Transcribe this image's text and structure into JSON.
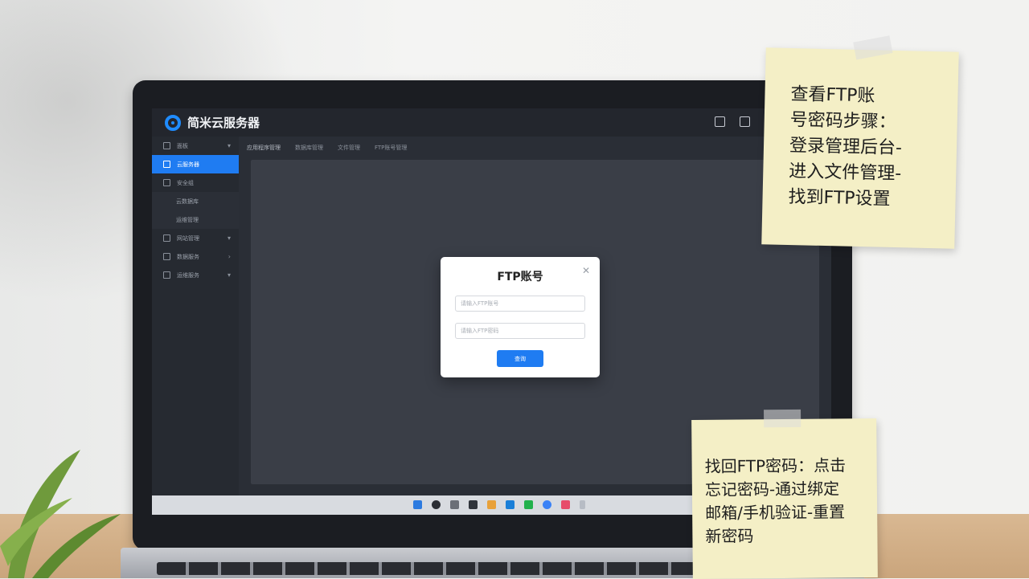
{
  "app": {
    "title": "简米云服务器"
  },
  "sidebar": {
    "items": [
      {
        "label": "面板",
        "active": false
      },
      {
        "label": "云服务器",
        "active": true
      },
      {
        "label": "安全组",
        "active": false
      },
      {
        "label": "云数据库",
        "active": false
      },
      {
        "label": "运维管理",
        "active": false
      },
      {
        "label": "网站管理",
        "active": false
      },
      {
        "label": "数据服务",
        "active": false
      },
      {
        "label": "运维服务",
        "active": false
      }
    ]
  },
  "tabs": [
    {
      "label": "应用程序管理",
      "active": true
    },
    {
      "label": "数据库管理",
      "active": false
    },
    {
      "label": "文件管理",
      "active": false
    },
    {
      "label": "FTP账号管理",
      "active": false
    }
  ],
  "modal": {
    "title": "FTP账号",
    "username_placeholder": "请输入FTP账号",
    "password_placeholder": "请输入FTP密码",
    "submit_label": "查询"
  },
  "notes": {
    "note1": "查看FTP账\n号密码步骤：\n登录管理后台-\n进入文件管理-\n找到FTP设置",
    "note2": "找回FTP密码：点击\n忘记密码-通过绑定\n邮箱/手机验证-重置\n新密码"
  },
  "colors": {
    "accent": "#1f7cf2",
    "screen_bg": "#2a2e36",
    "note_yellow": "#f4efc6"
  }
}
